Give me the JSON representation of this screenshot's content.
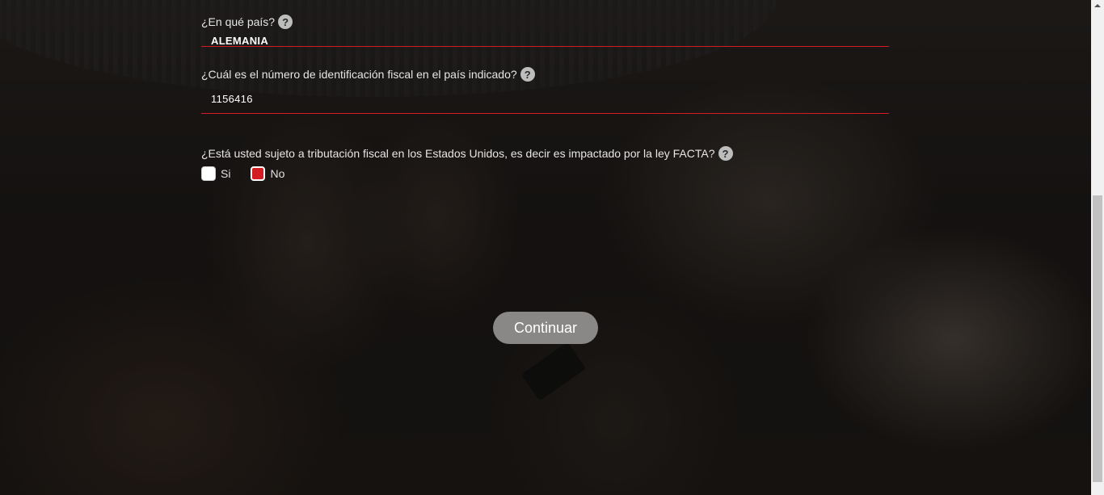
{
  "form": {
    "country": {
      "label": "¿En qué país?",
      "value": "ALEMANIA",
      "help": "?"
    },
    "tax_id": {
      "label": "¿Cuál es el número de identificación fiscal en el país indicado?",
      "value": "1156416",
      "help": "?"
    },
    "facta": {
      "label": "¿Está usted sujeto a tributación fiscal en los Estados Unidos, es decir es impactado por la ley FACTA?",
      "help": "?",
      "options": [
        {
          "label": "Si",
          "checked": false
        },
        {
          "label": "No",
          "checked": true
        }
      ]
    },
    "continue_label": "Continuar"
  },
  "colors": {
    "accent": "#d41c23",
    "button_bg": "#8a8886"
  }
}
